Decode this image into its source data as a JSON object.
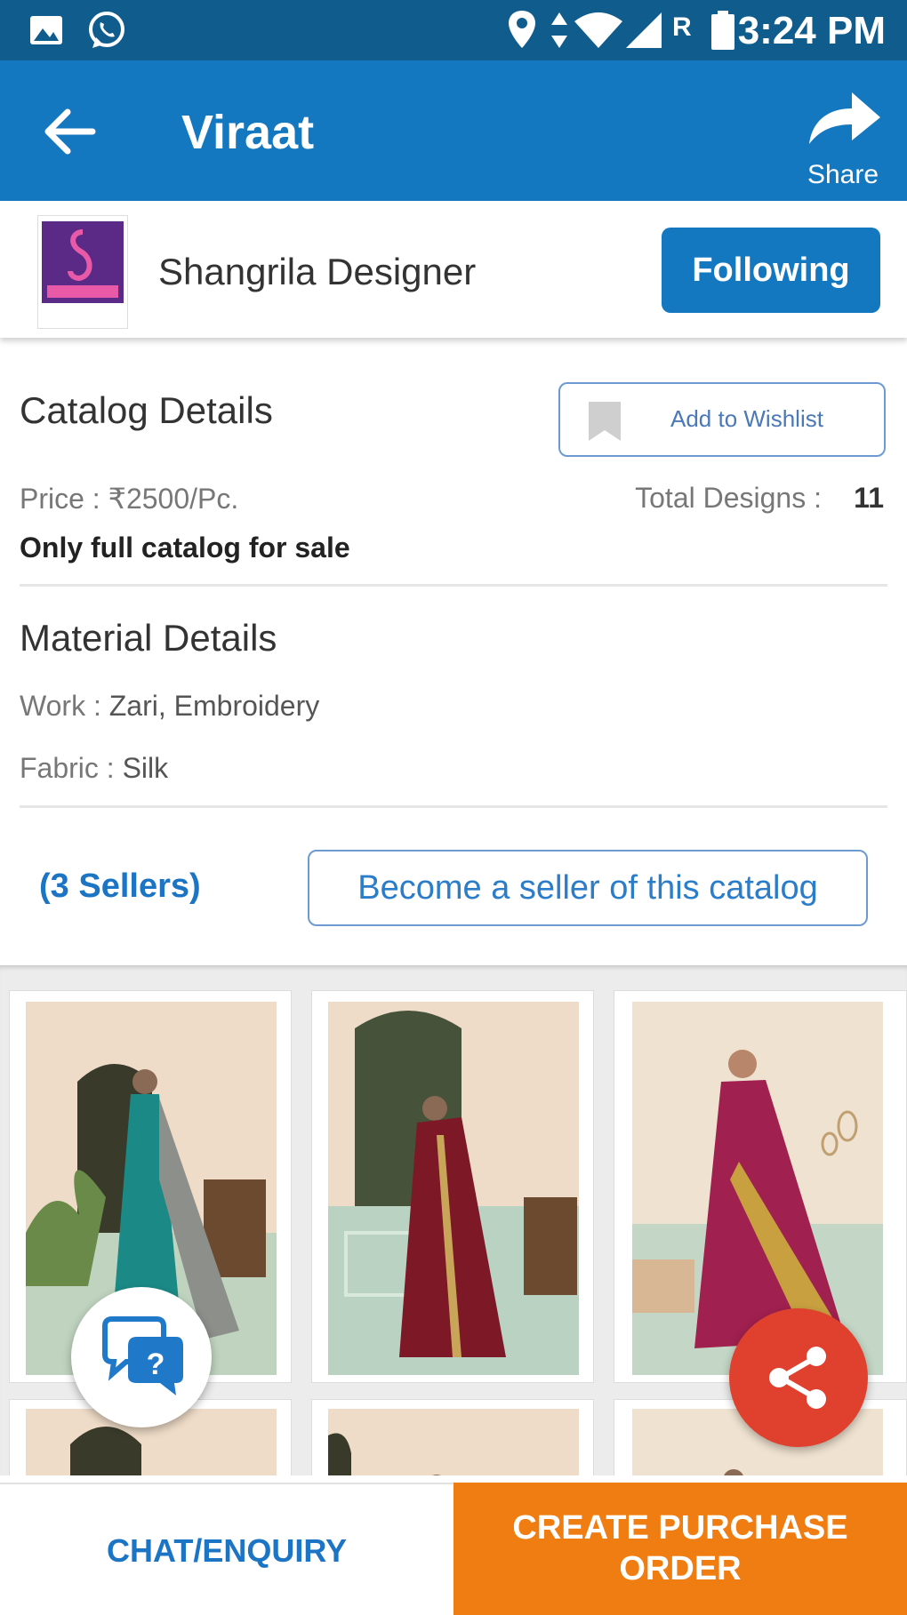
{
  "status_bar": {
    "time": "3:24 PM",
    "icons": [
      "image-icon",
      "whatsapp-icon",
      "location-icon",
      "data-arrows-icon",
      "wifi-icon",
      "signal-icon",
      "roaming-icon",
      "battery-icon"
    ],
    "roaming_label": "R"
  },
  "appbar": {
    "title": "Viraat",
    "share_label": "Share",
    "color": "#1478c0"
  },
  "seller": {
    "name": "Shangrila Designer",
    "follow_label": "Following"
  },
  "catalog": {
    "heading": "Catalog Details",
    "wishlist_label": "Add to Wishlist",
    "price": "Price : ₹2500/Pc.",
    "total_designs_label": "Total Designs :",
    "total_designs_value": "11",
    "sale_note": "Only full catalog for sale"
  },
  "material": {
    "heading": "Material Details",
    "work_label": "Work :",
    "work_value": "Zari, Embroidery",
    "fabric_label": "Fabric :",
    "fabric_value": "Silk"
  },
  "sellers": {
    "count_label": "(3 Sellers)",
    "become_label": "Become a seller of this catalog"
  },
  "bottom": {
    "chat_label": "CHAT/ENQUIRY",
    "po_line1": "CREATE PURCHASE",
    "po_line2": "ORDER",
    "po_color": "#f07d11"
  }
}
